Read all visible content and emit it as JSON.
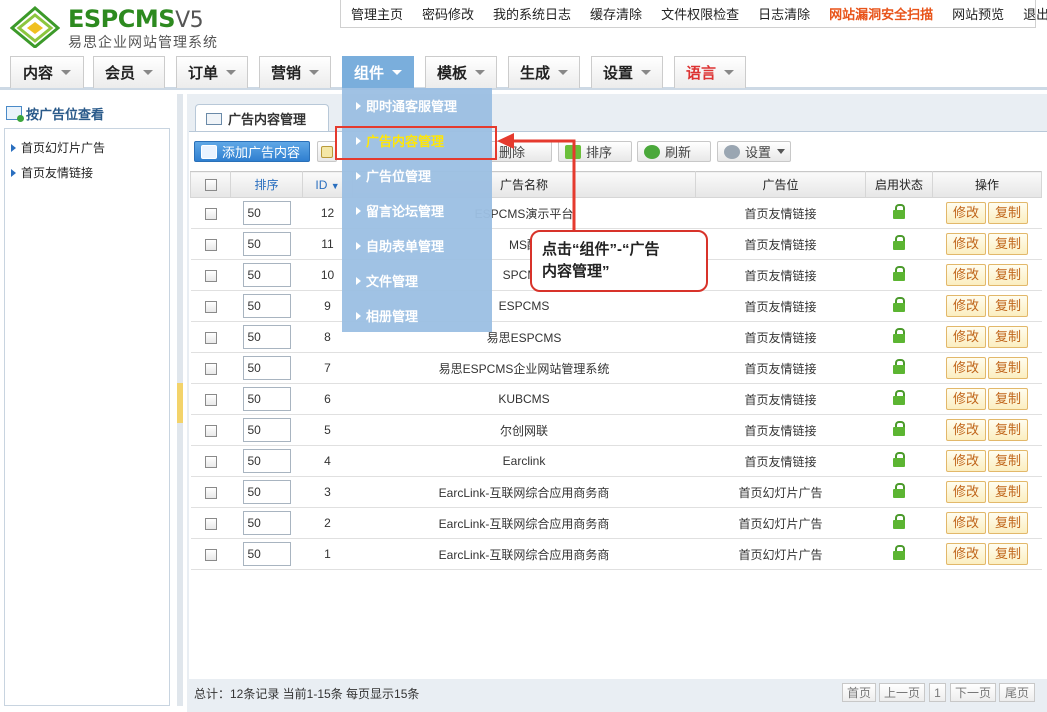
{
  "logo": {
    "name": "ESPCMS",
    "version": "V5",
    "subtitle": "易思企业网站管理系统"
  },
  "toplinks": [
    "管理主页",
    "密码修改",
    "我的系统日志",
    "缓存清除",
    "文件权限检查",
    "日志清除",
    "网站漏洞安全扫描",
    "网站预览",
    "退出"
  ],
  "nav": [
    "内容",
    "会员",
    "订单",
    "营销",
    "组件",
    "模板",
    "生成",
    "设置",
    "语言"
  ],
  "sidebar": {
    "title": "按广告位查看",
    "items": [
      "首页幻灯片广告",
      "首页友情链接"
    ]
  },
  "tab": {
    "label": "广告内容管理"
  },
  "toolbar": {
    "add": "添加广告内容",
    "delete": "删除",
    "sort": "排序",
    "refresh": "刷新",
    "settings": "设置"
  },
  "table": {
    "headers": {
      "sort": "排序",
      "id": "ID",
      "name": "广告名称",
      "position": "广告位",
      "status": "启用状态",
      "ops": "操作"
    },
    "rows": [
      {
        "sort": "50",
        "id": "12",
        "name": "ESPCMS演示平台",
        "position": "首页友情链接"
      },
      {
        "sort": "50",
        "id": "11",
        "name": "MS酷",
        "position": "首页友情链接"
      },
      {
        "sort": "50",
        "id": "10",
        "name": "SPCMS",
        "position": "首页友情链接"
      },
      {
        "sort": "50",
        "id": "9",
        "name": "ESPCMS",
        "position": "首页友情链接"
      },
      {
        "sort": "50",
        "id": "8",
        "name": "易思ESPCMS",
        "position": "首页友情链接"
      },
      {
        "sort": "50",
        "id": "7",
        "name": "易思ESPCMS企业网站管理系统",
        "position": "首页友情链接"
      },
      {
        "sort": "50",
        "id": "6",
        "name": "KUBCMS",
        "position": "首页友情链接"
      },
      {
        "sort": "50",
        "id": "5",
        "name": "尔创网联",
        "position": "首页友情链接"
      },
      {
        "sort": "50",
        "id": "4",
        "name": "Earclink",
        "position": "首页友情链接"
      },
      {
        "sort": "50",
        "id": "3",
        "name": "EarcLink-互联网综合应用商务商",
        "position": "首页幻灯片广告"
      },
      {
        "sort": "50",
        "id": "2",
        "name": "EarcLink-互联网综合应用商务商",
        "position": "首页幻灯片广告"
      },
      {
        "sort": "50",
        "id": "1",
        "name": "EarcLink-互联网综合应用商务商",
        "position": "首页幻灯片广告"
      }
    ],
    "edit_label": "修改",
    "copy_label": "复制"
  },
  "dropdown": [
    "即时通客服管理",
    "广告内容管理",
    "广告位管理",
    "留言论坛管理",
    "自助表单管理",
    "文件管理",
    "相册管理"
  ],
  "callout": {
    "line1": "点击“组件”-“广告",
    "line2": "内容管理”"
  },
  "footer": {
    "summary": "总计：12条记录 当前1-15条 每页显示15条"
  },
  "pager": {
    "first": "首页",
    "prev": "上一页",
    "page": "1",
    "next": "下一页",
    "last": "尾页"
  },
  "colors": {
    "accent": "#7aaedc",
    "highlight": "#e53a2e",
    "brand": "#2d8a1f"
  }
}
